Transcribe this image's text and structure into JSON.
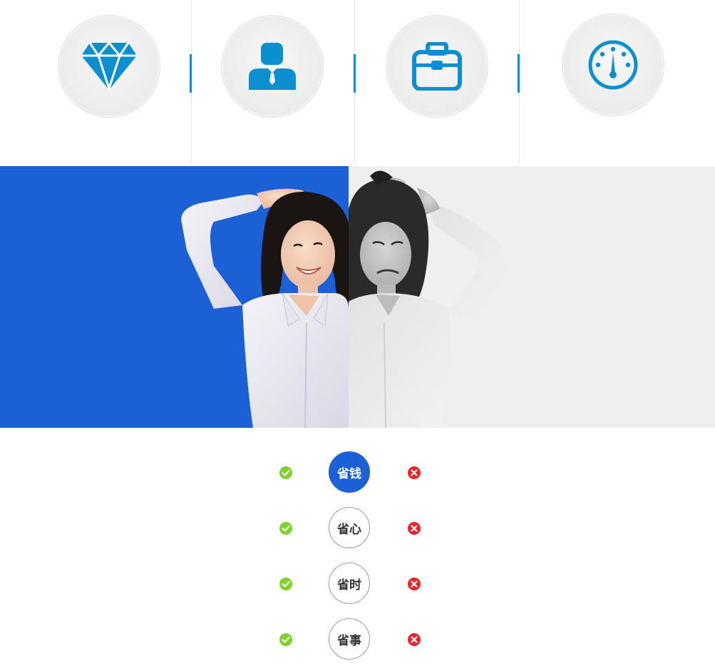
{
  "features": [
    {
      "icon": "diamond-icon"
    },
    {
      "icon": "businessman-icon"
    },
    {
      "icon": "briefcase-icon"
    },
    {
      "icon": "speedometer-icon"
    }
  ],
  "banner": {
    "left_label": "happy-woman",
    "right_label": "stressed-woman",
    "left_color": "#1c60d6",
    "right_color": "#efefef"
  },
  "comparison": {
    "rows": [
      {
        "label": "省钱",
        "active": true
      },
      {
        "label": "省心",
        "active": false
      },
      {
        "label": "省时",
        "active": false
      },
      {
        "label": "省事",
        "active": false
      }
    ]
  },
  "colors": {
    "accent": "#1c60d6",
    "icon_blue": "#0b8fd0",
    "check_green": "#7fd12b",
    "cross_red": "#e6262b"
  }
}
